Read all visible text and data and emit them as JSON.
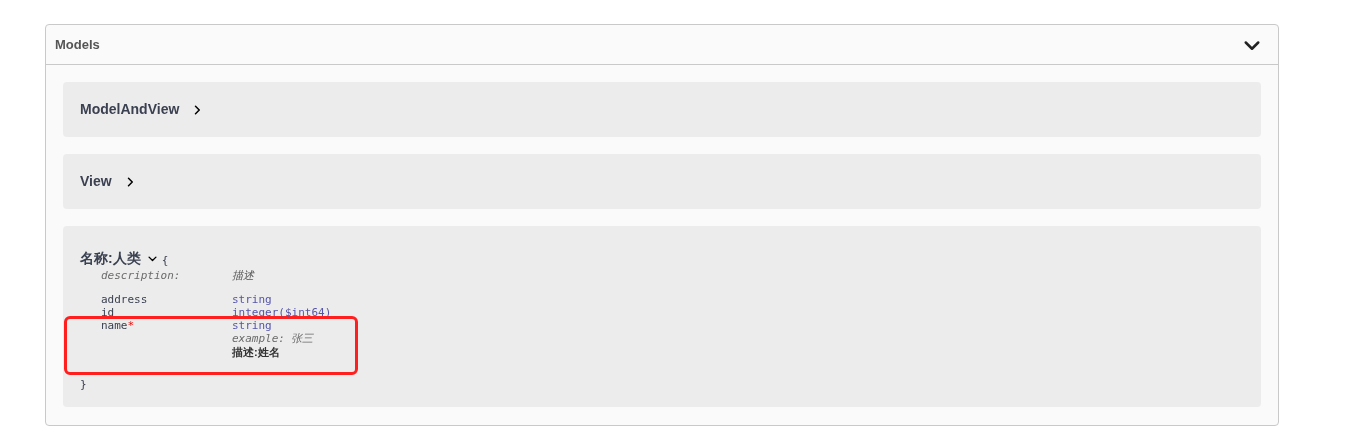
{
  "section": {
    "title": "Models",
    "expanded": true
  },
  "models": [
    {
      "kind": "collapsed",
      "name": "ModelAndView"
    },
    {
      "kind": "collapsed",
      "name": "View"
    },
    {
      "kind": "expanded",
      "name": "名称:人类",
      "open_brace": "{",
      "close_brace": "}",
      "description_label": "description:",
      "description": "描述",
      "properties": [
        {
          "name": "address",
          "type": "string",
          "highlighted": false
        },
        {
          "name": "id",
          "type": "integer($int64)",
          "highlighted": false
        },
        {
          "name": "name",
          "required_mark": "*",
          "type": "string",
          "example_label": "example:",
          "example": "张三",
          "note": "描述:姓名",
          "highlighted": true
        }
      ]
    }
  ]
}
